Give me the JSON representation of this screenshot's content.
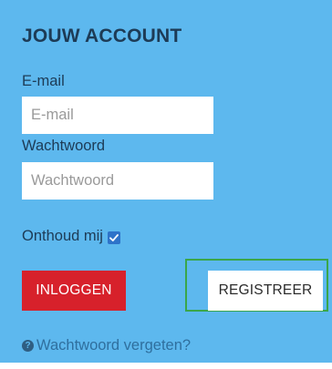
{
  "account": {
    "title": "JOUW ACCOUNT",
    "email_label": "E-mail",
    "email_placeholder": "E-mail",
    "email_value": "",
    "password_label": "Wachtwoord",
    "password_placeholder": "Wachtwoord",
    "password_value": "",
    "remember_label": "Onthoud mij",
    "remember_checked": true,
    "login_button": "INLOGGEN",
    "register_button": "REGISTREER",
    "forgot_icon": "?",
    "forgot_link": "Wachtwoord vergeten?"
  },
  "colors": {
    "panel_background": "#5db8ee",
    "heading_text": "#1d3b56",
    "login_button": "#d7212b",
    "register_highlight_border": "#3aa64a",
    "checkbox": "#2e73c9",
    "forgot_link": "#2f6f9e"
  },
  "icons": {
    "checkbox": "checkmark-icon",
    "forgot": "question-circle-icon"
  }
}
